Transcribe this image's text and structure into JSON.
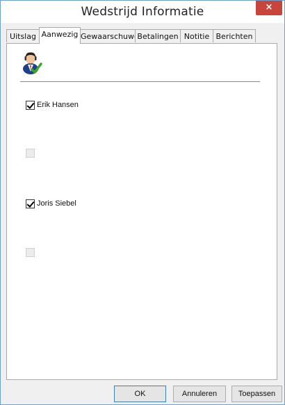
{
  "window": {
    "title": "Wedstrijd Informatie",
    "close_glyph": "×"
  },
  "tabs": [
    {
      "label": "Uitslag",
      "active": false
    },
    {
      "label": "Aanwezig",
      "active": true
    },
    {
      "label": "Gewaarschuwd",
      "active": false
    },
    {
      "label": "Betalingen",
      "active": false
    },
    {
      "label": "Notitie",
      "active": false
    },
    {
      "label": "Berichten",
      "active": false
    }
  ],
  "panel": {
    "icon": "person-check-icon",
    "checkboxes": [
      {
        "label": "Erik Hansen",
        "checked": true,
        "enabled": true
      },
      {
        "label": "",
        "checked": false,
        "enabled": false
      },
      {
        "label": "Joris Siebel",
        "checked": true,
        "enabled": true
      },
      {
        "label": "",
        "checked": false,
        "enabled": false
      }
    ]
  },
  "buttons": {
    "ok": "OK",
    "cancel": "Annuleren",
    "apply": "Toepassen"
  },
  "colors": {
    "close": "#c7453a",
    "window_border": "#6f9fcf",
    "panel_bg": "#ffffff",
    "dialog_bg": "#f0f0f0"
  }
}
